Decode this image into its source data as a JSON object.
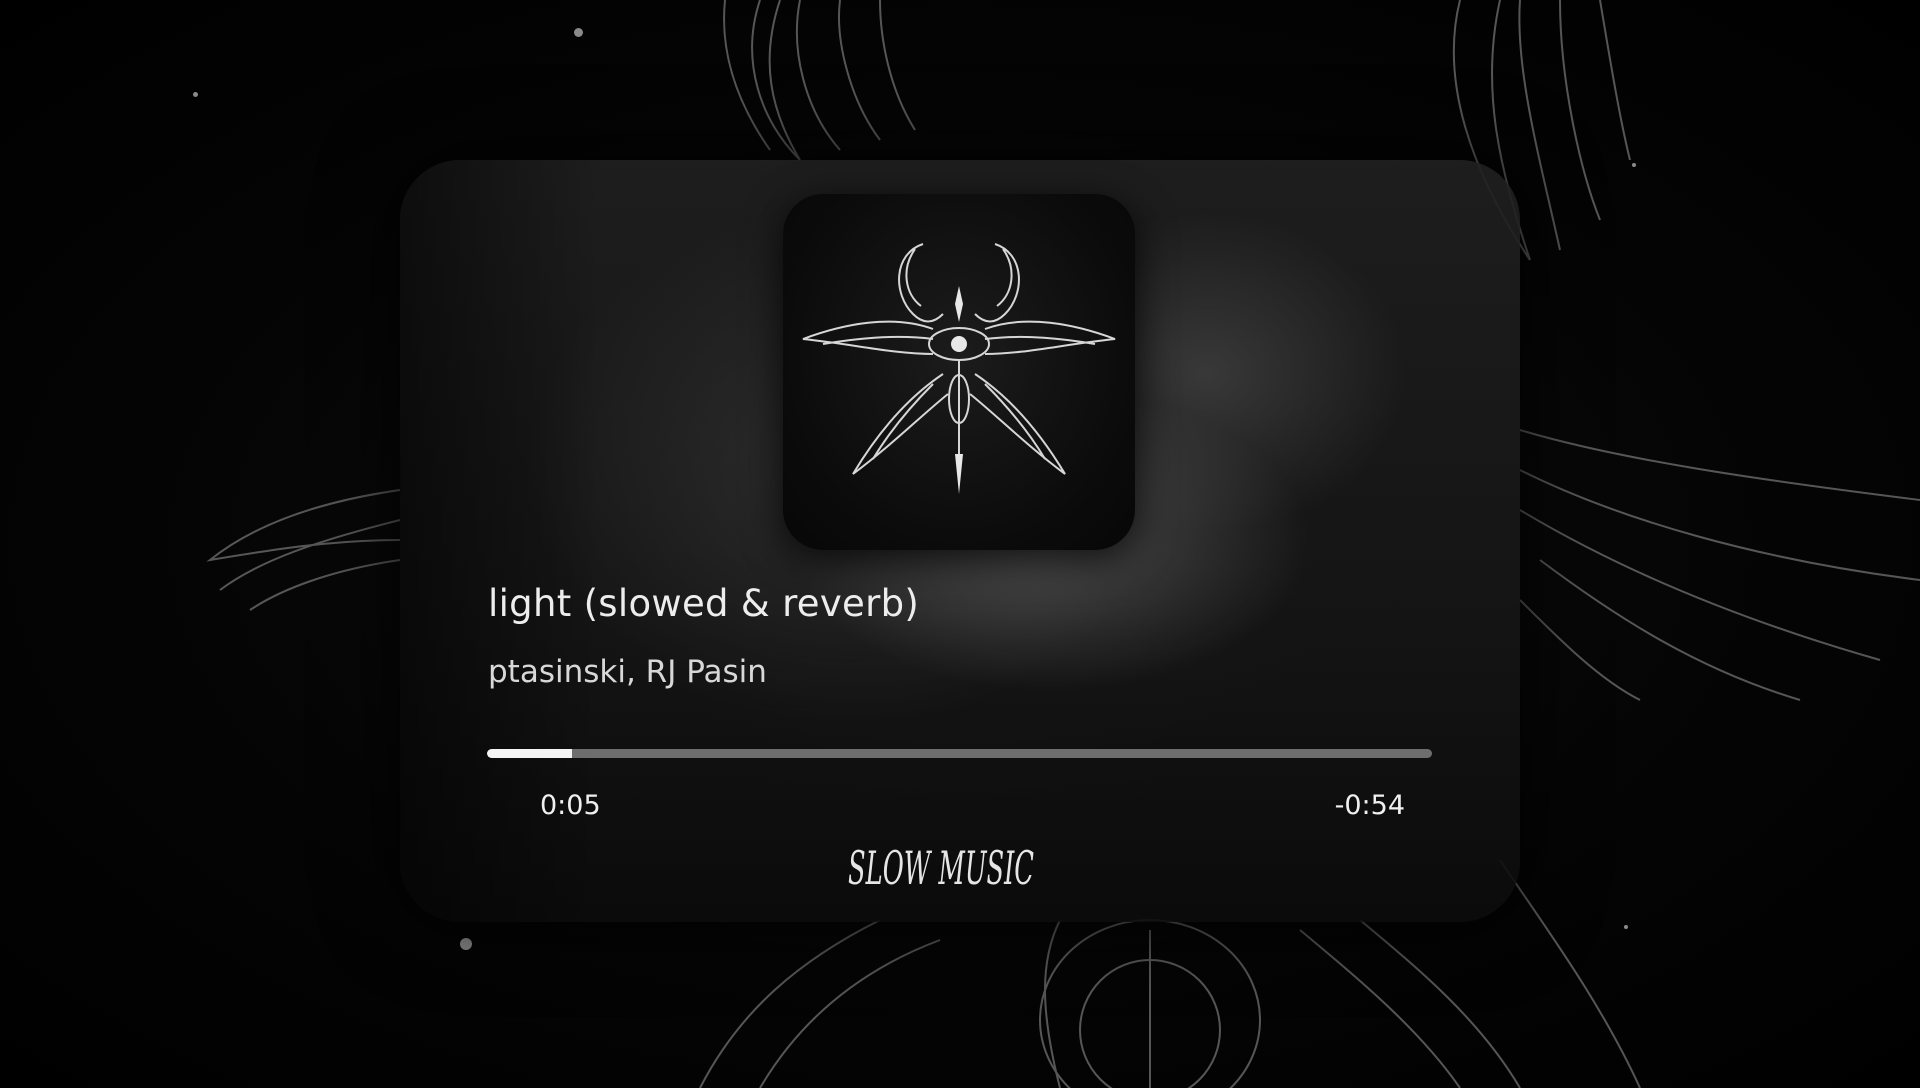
{
  "track": {
    "title": "light (slowed & reverb)",
    "artist": "ptasinski, RJ Pasin"
  },
  "playback": {
    "elapsed": "0:05",
    "remaining": "-0:54",
    "progress_fraction": 0.09
  },
  "branding": {
    "watermark": "SLOW MUSIC",
    "cover_art_icon": "winged-eye-emblem-icon",
    "background_art_icon": "angel-wings-icon"
  },
  "colors": {
    "background": "#000000",
    "card": "#1e1e1e",
    "text": "#ededed",
    "progress_fill": "#f4f4f4",
    "progress_track": "#6e6e6e"
  }
}
